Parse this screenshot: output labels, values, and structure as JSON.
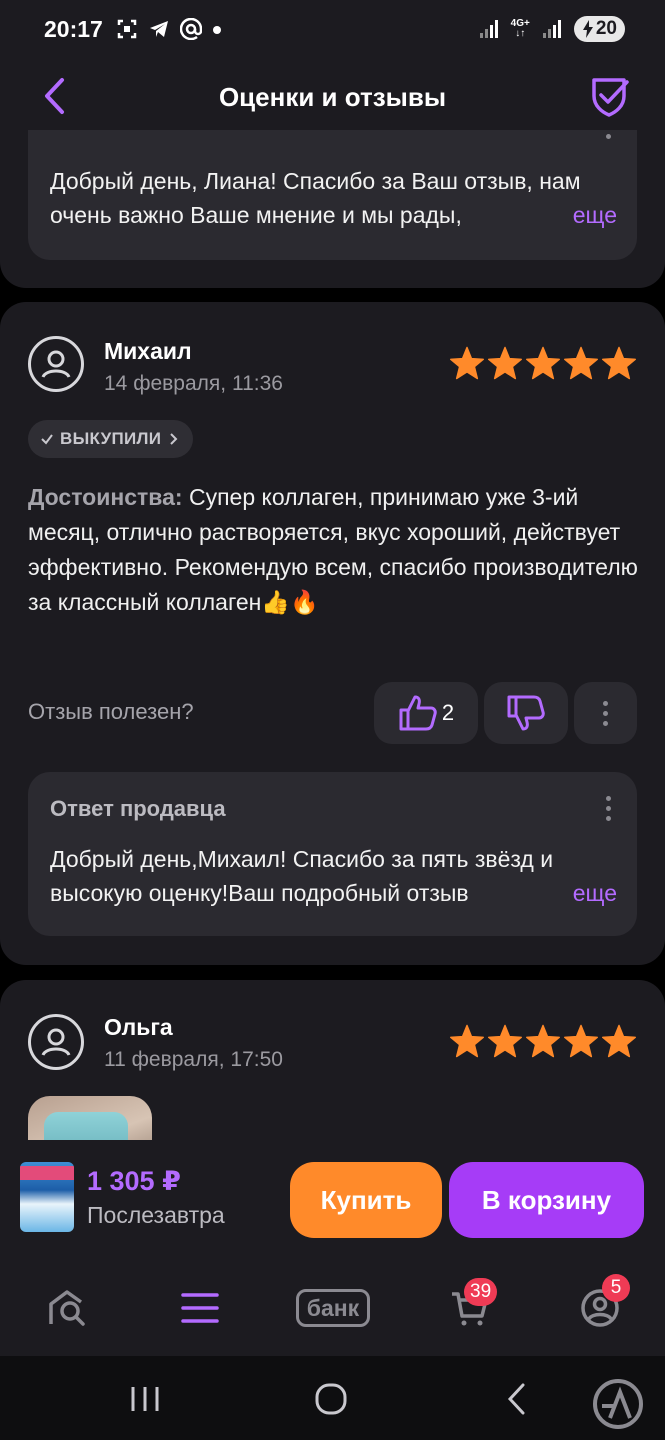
{
  "status_bar": {
    "time": "20:17",
    "network": "4G+",
    "battery": "20"
  },
  "header": {
    "title": "Оценки и отзывы"
  },
  "top_reply": {
    "text": "Добрый день, Лиана! Спасибо за Ваш отзыв, нам очень важно Ваше мнение и мы рады,",
    "more": "еще"
  },
  "reviews": [
    {
      "name": "Михаил",
      "date": "14 февраля, 11:36",
      "rating": 5,
      "badge": "ВЫКУПИЛИ",
      "pros_label": "Достоинства:",
      "pros_text": " Супер коллаген, принимаю уже 3-ий месяц, отлично растворяется, вкус хороший, действует эффективно. Рекомендую всем, спасибо производителю за классный коллаген👍🔥",
      "helpful_label": "Отзыв полезен?",
      "likes": "2",
      "seller_reply": {
        "title": "Ответ продавца",
        "text": "Добрый день,Михаил! Спасибо за пять звёзд и высокую оценку!Ваш подробный отзыв",
        "more": "еще"
      }
    },
    {
      "name": "Ольга",
      "date": "11 февраля, 17:50",
      "rating": 5
    }
  ],
  "buy_bar": {
    "price": "1 305 ₽",
    "delivery": "Послезавтра",
    "buy_label": "Купить",
    "cart_label": "В корзину"
  },
  "tabbar": {
    "bank_label": "банк",
    "cart_badge": "39",
    "profile_badge": "5"
  },
  "colors": {
    "accent_purple": "#a63cf7",
    "accent_orange": "#ff8a2a",
    "star": "#ff8a2a",
    "badge_red": "#ef3b55",
    "card_bg": "#1c1b20"
  }
}
